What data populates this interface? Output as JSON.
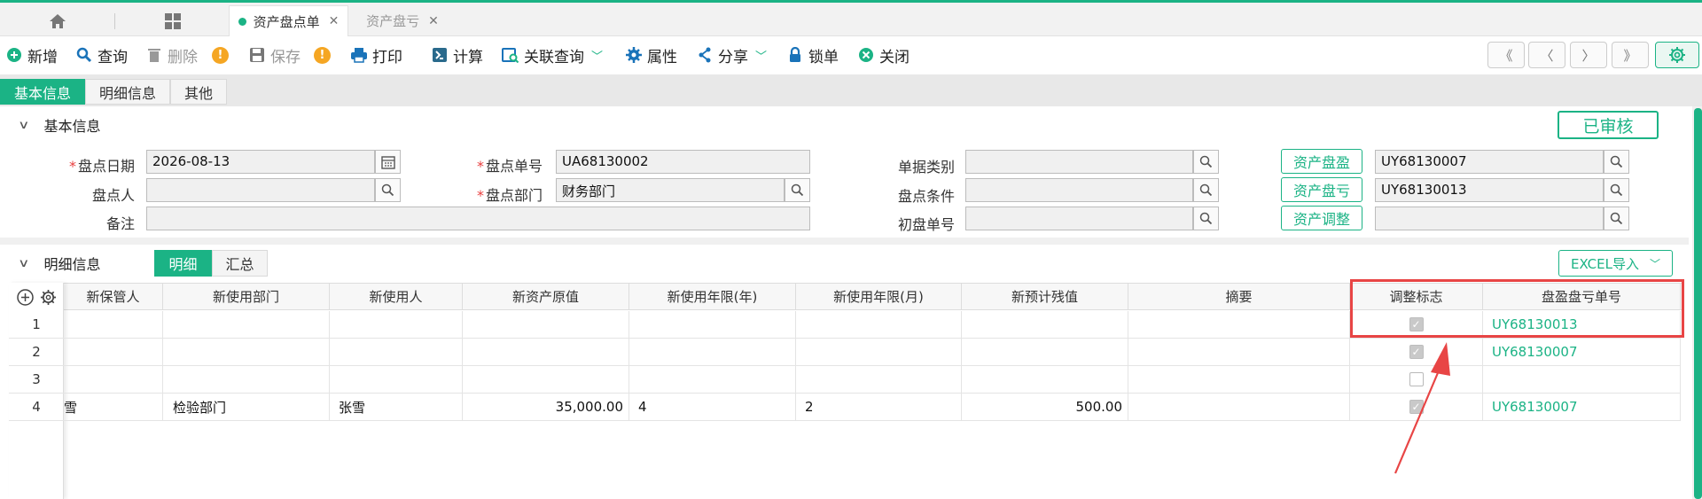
{
  "tabs": {
    "active_label": "资产盘点单",
    "inactive_label": "资产盘亏",
    "close_symbol": "✕"
  },
  "toolbar": {
    "new": "新增",
    "query": "查询",
    "delete": "删除",
    "save": "保存",
    "print": "打印",
    "calc": "计算",
    "related_query": "关联查询",
    "property": "属性",
    "share": "分享",
    "lock": "锁单",
    "close": "关闭",
    "warn_symbol": "!"
  },
  "section_tabs": [
    "基本信息",
    "明细信息",
    "其他"
  ],
  "basic": {
    "title": "基本信息",
    "status": "已审核",
    "fields": {
      "date_label": "盘点日期",
      "date_value": "2026-08-13",
      "person_label": "盘点人",
      "person_value": "",
      "note_label": "备注",
      "note_value": "",
      "doc_no_label": "盘点单号",
      "doc_no_value": "UA68130002",
      "dept_label": "盘点部门",
      "dept_value": "财务部门",
      "doc_type_label": "单据类别",
      "doc_type_value": "",
      "condition_label": "盘点条件",
      "condition_value": "",
      "init_no_label": "初盘单号",
      "init_no_value": "",
      "surplus_btn": "资产盘盈",
      "surplus_value": "UY68130007",
      "loss_btn": "资产盘亏",
      "loss_value": "UY68130013",
      "adjust_btn": "资产调整",
      "adjust_value": ""
    },
    "required_mark": "*"
  },
  "detail": {
    "title": "明细信息",
    "tabs": [
      "明细",
      "汇总"
    ],
    "excel_label": "EXCEL导入",
    "columns": [
      "新保管人",
      "新使用部门",
      "新使用人",
      "新资产原值",
      "新使用年限(年)",
      "新使用年限(月)",
      "新预计残值",
      "摘要",
      "调整标志",
      "盘盈盘亏单号"
    ],
    "rows": [
      {
        "num": "1",
        "keeper": "",
        "dept": "",
        "user": "",
        "value": "",
        "years": "",
        "months": "",
        "residual": "",
        "summary": "",
        "adjusted": true,
        "order_no": "UY68130013"
      },
      {
        "num": "2",
        "keeper": "",
        "dept": "",
        "user": "",
        "value": "",
        "years": "",
        "months": "",
        "residual": "",
        "summary": "",
        "adjusted": true,
        "order_no": "UY68130007"
      },
      {
        "num": "3",
        "keeper": "",
        "dept": "",
        "user": "",
        "value": "",
        "years": "",
        "months": "",
        "residual": "",
        "summary": "",
        "adjusted": false,
        "order_no": ""
      },
      {
        "num": "4",
        "keeper": "雪",
        "dept": "检验部门",
        "user": "张雪",
        "value": "35,000.00",
        "years": "4",
        "months": "2",
        "residual": "500.00",
        "summary": "",
        "adjusted": true,
        "order_no": "UY68130007"
      }
    ]
  },
  "colors": {
    "accent": "#1bb385",
    "annotation": "#e84545",
    "warning": "#f5a623"
  }
}
